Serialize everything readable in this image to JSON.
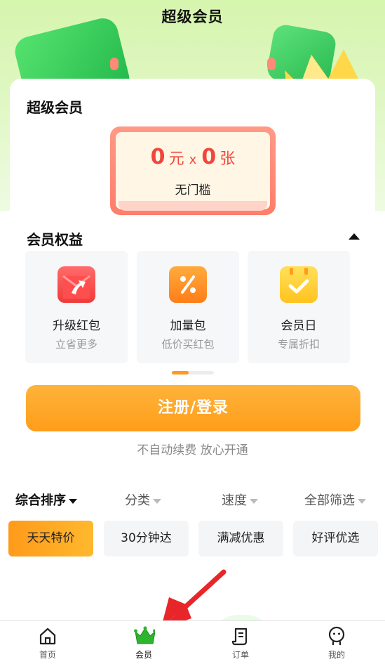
{
  "header": {
    "title": "超级会员"
  },
  "card": {
    "title": "超级会员",
    "coupon": {
      "amount": "0",
      "unit": "元",
      "times": "x",
      "count": "0",
      "count_unit": "张",
      "threshold": "无门槛"
    }
  },
  "benefits": {
    "title": "会员权益",
    "items": [
      {
        "name": "升级红包",
        "sub": "立省更多",
        "icon": "upgrade-redpacket-icon"
      },
      {
        "name": "加量包",
        "sub": "低价买红包",
        "icon": "percent-coupon-icon"
      },
      {
        "name": "会员日",
        "sub": "专属折扣",
        "icon": "calendar-check-icon"
      }
    ]
  },
  "actions": {
    "register_login": "注册/登录",
    "note": "不自动续费 放心开通"
  },
  "sort_bar": {
    "items": [
      "综合排序",
      "分类",
      "速度",
      "全部筛选"
    ]
  },
  "filter_chips": [
    "天天特价",
    "30分钟达",
    "满减优惠",
    "好评优选"
  ],
  "tabbar": {
    "items": [
      "首页",
      "会员",
      "订单",
      "我的"
    ],
    "active": "会员"
  },
  "colors": {
    "accent": "#ff9d1a",
    "coupon_red": "#f0473c",
    "brand_green": "#22b84a"
  }
}
